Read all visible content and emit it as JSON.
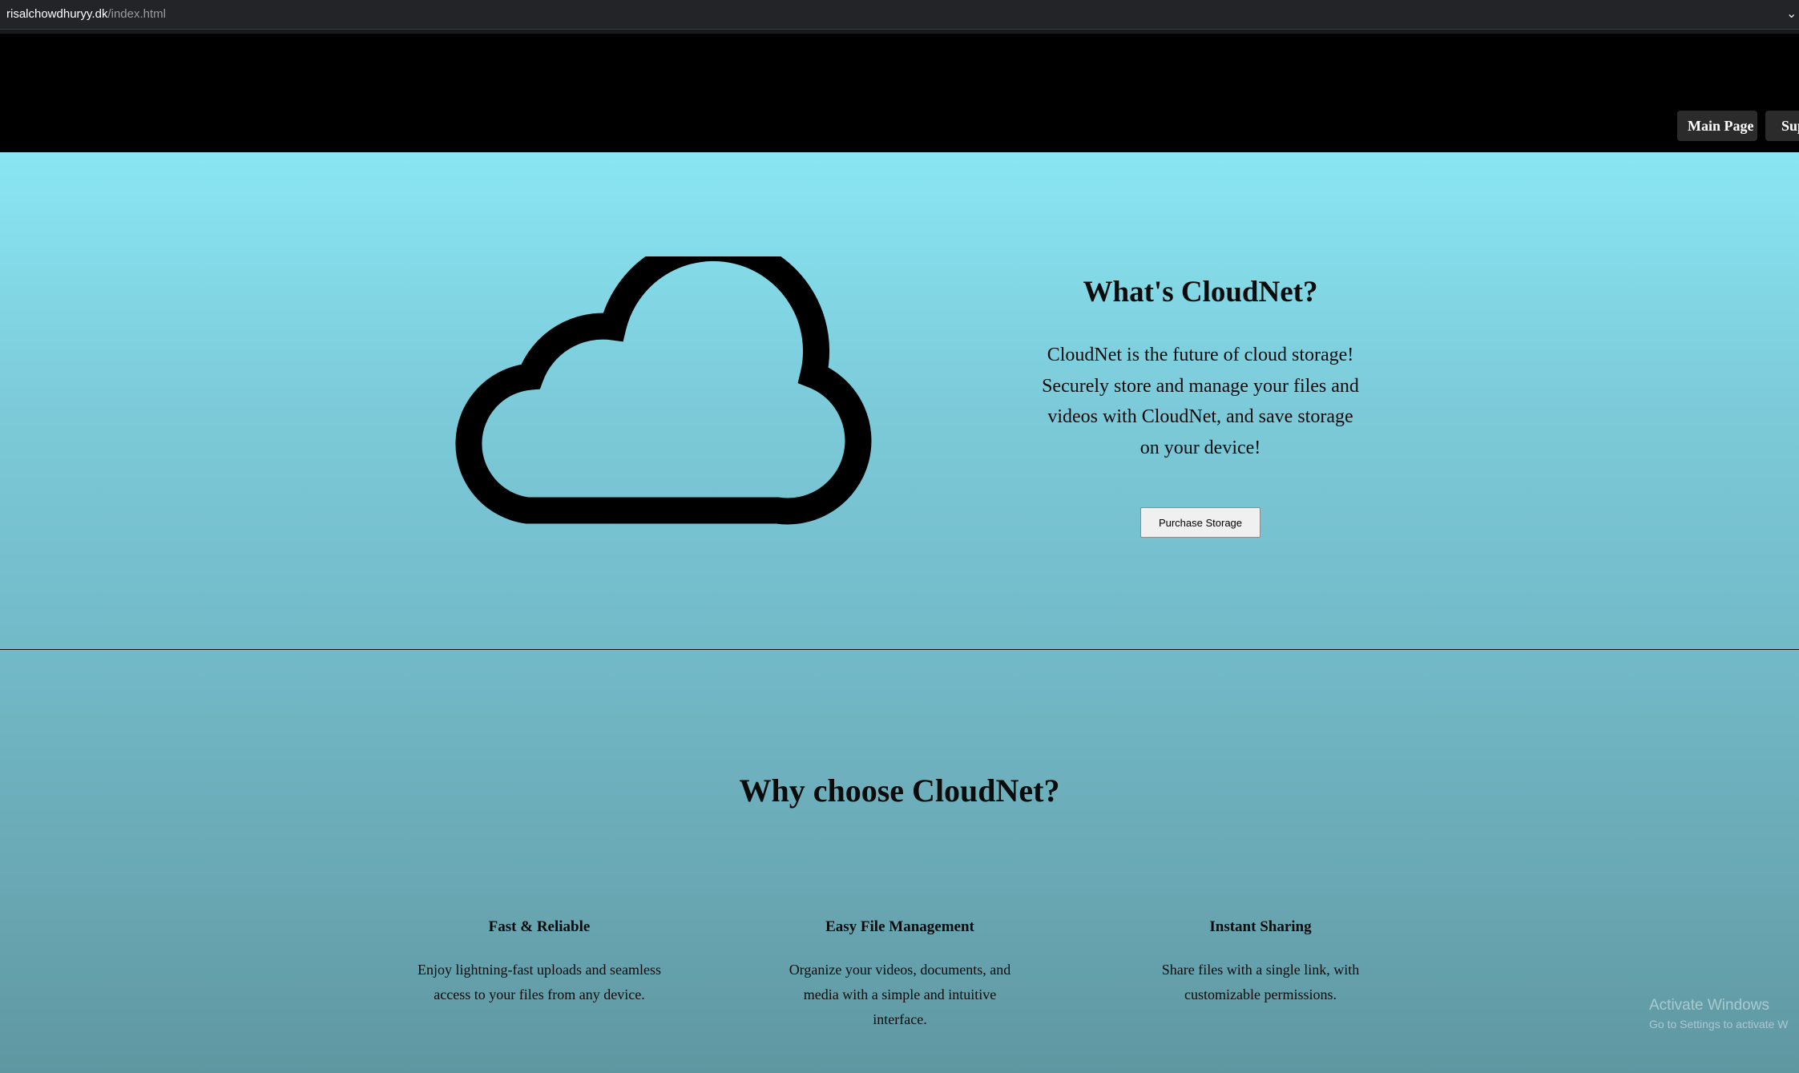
{
  "browser": {
    "url_host": "risalchowdhuryy.dk",
    "url_path": "/index.html"
  },
  "nav": {
    "items": [
      {
        "label": "Main Page"
      },
      {
        "label": "Sup"
      }
    ]
  },
  "hero": {
    "icon": "cloud-icon",
    "title": "What's CloudNet?",
    "text": "CloudNet is the future of cloud storage! Securely store and manage your files and videos with CloudNet, and save storage on your device!",
    "button_label": "Purchase Storage"
  },
  "why": {
    "title": "Why choose CloudNet?",
    "features": [
      {
        "title": "Fast & Reliable",
        "text": "Enjoy lightning-fast uploads and seamless access to your files from any device."
      },
      {
        "title": "Easy File Management",
        "text": "Organize your videos, documents, and media with a simple and intuitive interface."
      },
      {
        "title": "Instant Sharing",
        "text": "Share files with a single link, with customizable permissions."
      }
    ]
  },
  "watermark": {
    "title": "Activate Windows",
    "subtitle": "Go to Settings to activate W"
  },
  "colors": {
    "navbar": "#000000",
    "nav_button": "#2b2b2b",
    "gradient_top": "#8ae6f3",
    "gradient_bottom": "#5f97a1"
  }
}
